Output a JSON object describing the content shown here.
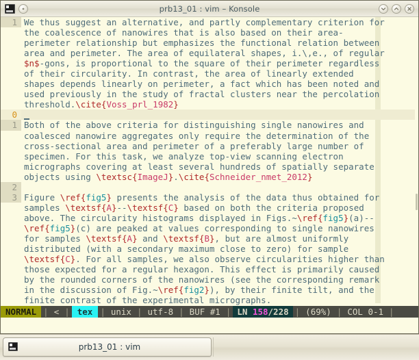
{
  "window": {
    "title": "prb13_01 : vim – Konsole",
    "app_icon": "terminal-icon",
    "buttons": {
      "shade": "shade-button",
      "minimize": "minimize-button",
      "maximize": "maximize-button",
      "close": "close-button"
    }
  },
  "editor": {
    "lines": [
      {
        "num": "1",
        "cursor": false,
        "segments": [
          {
            "t": "We thus suggest an alternative, and partly complementary criterion for",
            "c": "plain"
          }
        ]
      },
      {
        "num": "",
        "cursor": false,
        "segments": [
          {
            "t": "the coalescence of nanowires that is also based on their area-",
            "c": "plain"
          }
        ]
      },
      {
        "num": "",
        "cursor": false,
        "segments": [
          {
            "t": "perimeter relationship but emphasizes the functional relation between",
            "c": "plain"
          }
        ]
      },
      {
        "num": "",
        "cursor": false,
        "segments": [
          {
            "t": "area and perimeter. The area of equilateral shapes, i.\\,e., of regular",
            "c": "plain"
          }
        ]
      },
      {
        "num": "",
        "cursor": false,
        "segments": [
          {
            "t": "$n$",
            "c": "kw"
          },
          {
            "t": "-gons, is proportional to the square of their perimeter regardless",
            "c": "plain"
          }
        ]
      },
      {
        "num": "",
        "cursor": false,
        "segments": [
          {
            "t": "of their circularity. In contrast, the area of linearly extended",
            "c": "plain"
          }
        ]
      },
      {
        "num": "",
        "cursor": false,
        "segments": [
          {
            "t": "shapes depends linearly on perimeter, a fact which has been noted and",
            "c": "plain"
          }
        ]
      },
      {
        "num": "",
        "cursor": false,
        "segments": [
          {
            "t": "used previously in the study of fractal clusters near the percolation",
            "c": "plain"
          }
        ]
      },
      {
        "num": "",
        "cursor": false,
        "segments": [
          {
            "t": "threshold.",
            "c": "plain"
          },
          {
            "t": "\\cite",
            "c": "kw"
          },
          {
            "t": "{",
            "c": "brc"
          },
          {
            "t": "Voss_prl_1982",
            "c": "arg"
          },
          {
            "t": "}",
            "c": "brc"
          }
        ]
      },
      {
        "num": "0",
        "cursor": true,
        "segments": [
          {
            "t": "",
            "c": "plain"
          }
        ]
      },
      {
        "num": "1",
        "cursor": false,
        "segments": [
          {
            "t": "Both of the above criteria for distinguishing single nanowires and",
            "c": "plain"
          }
        ]
      },
      {
        "num": "",
        "cursor": false,
        "segments": [
          {
            "t": "coalesced nanowire aggregates only require the determination of the",
            "c": "plain"
          }
        ]
      },
      {
        "num": "",
        "cursor": false,
        "segments": [
          {
            "t": "cross-sectional area and perimeter of a preferably large number of",
            "c": "plain"
          }
        ]
      },
      {
        "num": "",
        "cursor": false,
        "segments": [
          {
            "t": "specimen. For this task, we analyze top-view scanning electron",
            "c": "plain"
          }
        ]
      },
      {
        "num": "",
        "cursor": false,
        "segments": [
          {
            "t": "micrographs covering at least several hundreds of spatially separate",
            "c": "plain"
          }
        ]
      },
      {
        "num": "",
        "cursor": false,
        "segments": [
          {
            "t": "objects using ",
            "c": "plain"
          },
          {
            "t": "\\textsc",
            "c": "kw"
          },
          {
            "t": "{",
            "c": "brc"
          },
          {
            "t": "ImageJ",
            "c": "arg"
          },
          {
            "t": "}",
            "c": "brc"
          },
          {
            "t": ".",
            "c": "plain"
          },
          {
            "t": "\\cite",
            "c": "kw"
          },
          {
            "t": "{",
            "c": "brc"
          },
          {
            "t": "Schneider_nmet_2012",
            "c": "arg"
          },
          {
            "t": "}",
            "c": "brc"
          }
        ]
      },
      {
        "num": "2",
        "cursor": false,
        "segments": [
          {
            "t": "",
            "c": "plain"
          }
        ]
      },
      {
        "num": "3",
        "cursor": false,
        "segments": [
          {
            "t": "Figure ",
            "c": "plain"
          },
          {
            "t": "\\ref",
            "c": "kw"
          },
          {
            "t": "{",
            "c": "brc"
          },
          {
            "t": "fig5",
            "c": "arg2"
          },
          {
            "t": "}",
            "c": "brc"
          },
          {
            "t": " presents the analysis of the data thus obtained for",
            "c": "plain"
          }
        ]
      },
      {
        "num": "",
        "cursor": false,
        "segments": [
          {
            "t": "samples ",
            "c": "plain"
          },
          {
            "t": "\\textsf",
            "c": "kw"
          },
          {
            "t": "{",
            "c": "brc"
          },
          {
            "t": "A",
            "c": "arg"
          },
          {
            "t": "}",
            "c": "brc"
          },
          {
            "t": "--",
            "c": "plain"
          },
          {
            "t": "\\textsf",
            "c": "kw"
          },
          {
            "t": "{",
            "c": "brc"
          },
          {
            "t": "C",
            "c": "arg"
          },
          {
            "t": "}",
            "c": "brc"
          },
          {
            "t": " based on both the criteria proposed",
            "c": "plain"
          }
        ]
      },
      {
        "num": "",
        "cursor": false,
        "segments": [
          {
            "t": "above. The circularity histograms displayed in Figs.~",
            "c": "plain"
          },
          {
            "t": "\\ref",
            "c": "kw"
          },
          {
            "t": "{",
            "c": "brc"
          },
          {
            "t": "fig5",
            "c": "arg2"
          },
          {
            "t": "}",
            "c": "brc"
          },
          {
            "t": "(a)--",
            "c": "plain"
          }
        ]
      },
      {
        "num": "",
        "cursor": false,
        "segments": [
          {
            "t": "\\ref",
            "c": "kw"
          },
          {
            "t": "{",
            "c": "brc"
          },
          {
            "t": "fig5",
            "c": "arg2"
          },
          {
            "t": "}",
            "c": "brc"
          },
          {
            "t": "(c) are peaked at values corresponding to single nanowires",
            "c": "plain"
          }
        ]
      },
      {
        "num": "",
        "cursor": false,
        "segments": [
          {
            "t": "for samples ",
            "c": "plain"
          },
          {
            "t": "\\textsf",
            "c": "kw"
          },
          {
            "t": "{",
            "c": "brc"
          },
          {
            "t": "A",
            "c": "arg"
          },
          {
            "t": "}",
            "c": "brc"
          },
          {
            "t": " and ",
            "c": "plain"
          },
          {
            "t": "\\textsf",
            "c": "kw"
          },
          {
            "t": "{",
            "c": "brc"
          },
          {
            "t": "B",
            "c": "arg"
          },
          {
            "t": "}",
            "c": "brc"
          },
          {
            "t": ", but are almost uniformly",
            "c": "plain"
          }
        ]
      },
      {
        "num": "",
        "cursor": false,
        "segments": [
          {
            "t": "distributed (with a secondary maximum close to zero) for sample",
            "c": "plain"
          }
        ]
      },
      {
        "num": "",
        "cursor": false,
        "segments": [
          {
            "t": "\\textsf",
            "c": "kw"
          },
          {
            "t": "{",
            "c": "brc"
          },
          {
            "t": "C",
            "c": "arg"
          },
          {
            "t": "}",
            "c": "brc"
          },
          {
            "t": ". For all samples, we also observe circularities higher than",
            "c": "plain"
          }
        ]
      },
      {
        "num": "",
        "cursor": false,
        "segments": [
          {
            "t": "those expected for a regular hexagon. This effect is primarily caused",
            "c": "plain"
          }
        ]
      },
      {
        "num": "",
        "cursor": false,
        "segments": [
          {
            "t": "by the rounded corners of the nanowires (see the corresponding remark",
            "c": "plain"
          }
        ]
      },
      {
        "num": "",
        "cursor": false,
        "segments": [
          {
            "t": "in the discussion of Fig.~",
            "c": "plain"
          },
          {
            "t": "\\ref",
            "c": "kw"
          },
          {
            "t": "{",
            "c": "brc"
          },
          {
            "t": "fig2",
            "c": "arg2"
          },
          {
            "t": "}",
            "c": "brc"
          },
          {
            "t": "), by their finite tilt, and the",
            "c": "plain"
          }
        ]
      },
      {
        "num": "",
        "cursor": false,
        "segments": [
          {
            "t": "finite contrast of the experimental micrographs.",
            "c": "plain"
          }
        ]
      }
    ]
  },
  "statusline": {
    "mode": "NORMAL",
    "sep": "|",
    "branch": "<",
    "filetype": "tex",
    "fileformat": "unix",
    "encoding": "utf-8",
    "buffer": "BUF #1",
    "ln_label": "LN",
    "ln_current": "158",
    "ln_total": "/228",
    "percent": "(69%)",
    "col": "COL 0-1"
  },
  "taskbar": {
    "item_label": "prb13_01 : vim",
    "item_icon": "terminal-icon"
  },
  "colors": {
    "terminal_bg": "#fcfbe3",
    "gutter_bg": "#e0ddc2",
    "text_fg": "#4e6c79",
    "mode_bg": "#9a9b08",
    "filetype_bg": "#29f2f2",
    "ln_bg": "#123b3b",
    "ln_number_fg": "#f055d8",
    "status_bg": "#4a4a43"
  }
}
